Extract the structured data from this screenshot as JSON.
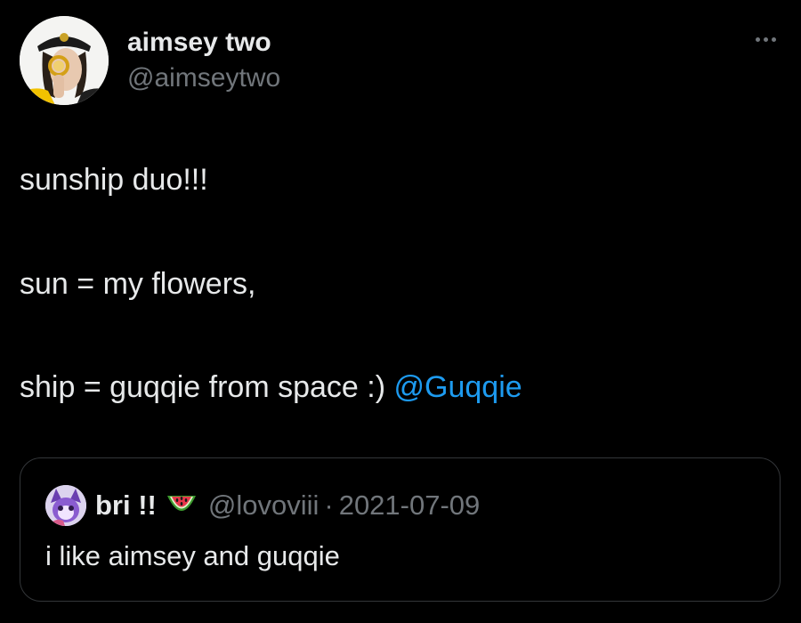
{
  "tweet": {
    "author": {
      "display_name": "aimsey two",
      "handle": "@aimseytwo"
    },
    "lines": [
      "sunship duo!!!",
      "sun = my flowers,",
      "ship = guqqie from space :)"
    ],
    "mention": "@Guqqie"
  },
  "quoted_tweet": {
    "display_name": "bri !!",
    "emoji": "watermelon-icon",
    "handle": "@lovoviii",
    "separator": "·",
    "date": "2021-07-09",
    "text": "i like aimsey and guqqie"
  },
  "colors": {
    "background": "#000000",
    "primary_text": "#e7e9ea",
    "secondary_text": "#71767b",
    "link": "#1d9bf0",
    "border": "#333639"
  }
}
